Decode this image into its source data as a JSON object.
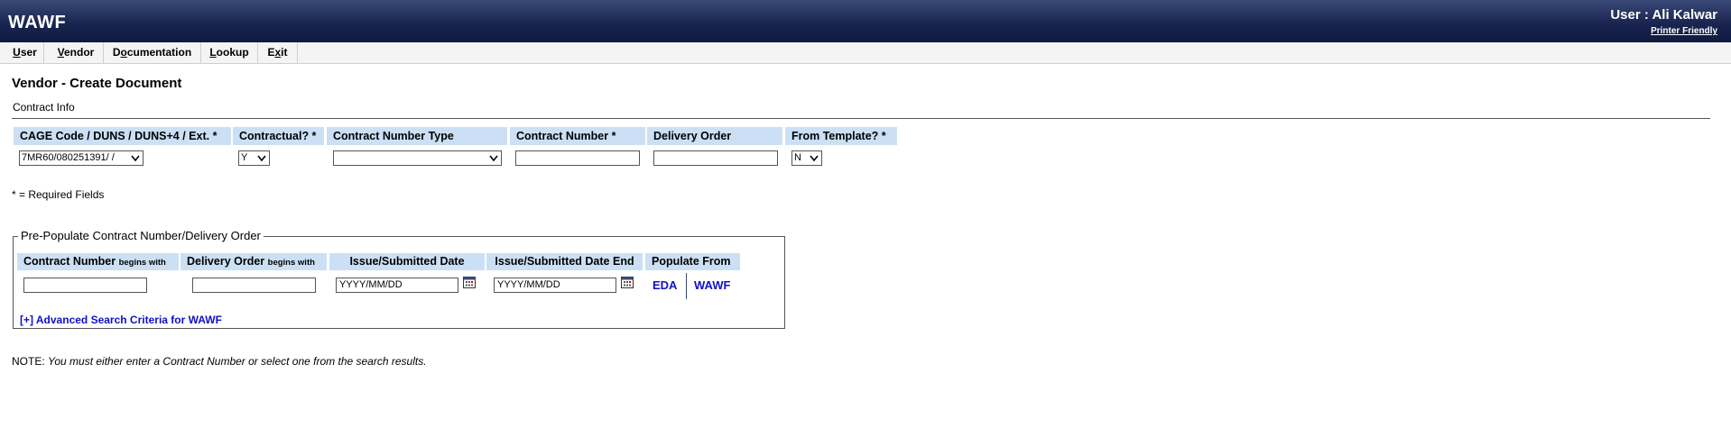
{
  "header": {
    "app_title": "WAWF",
    "user_label": "User : Ali Kalwar",
    "printer_friendly": "Printer Friendly"
  },
  "menu": [
    {
      "underline": "U",
      "rest": "ser"
    },
    {
      "underline": "V",
      "rest": "endor"
    },
    {
      "pre": "D",
      "underline": "o",
      "rest": "cumentation"
    },
    {
      "underline": "L",
      "rest": "ookup"
    },
    {
      "pre": "E",
      "underline": "x",
      "rest": "it"
    }
  ],
  "page": {
    "title": "Vendor - Create Document",
    "section": "Contract Info"
  },
  "contract_info": {
    "headers": {
      "cage": "CAGE Code / DUNS / DUNS+4 / Ext. *",
      "contractual": "Contractual? *",
      "contract_type": "Contract Number Type",
      "contract_number": "Contract Number *",
      "delivery_order": "Delivery Order",
      "from_template": "From Template? *"
    },
    "values": {
      "cage": "7MR60/080251391/ /",
      "contractual": "Y",
      "contract_type": "",
      "contract_number": "",
      "delivery_order": "",
      "from_template": "N"
    }
  },
  "required_note": "* = Required Fields",
  "prepopulate": {
    "legend": "Pre-Populate Contract Number/Delivery Order",
    "headers": {
      "contract_number": "Contract Number",
      "contract_number_small": "begins with",
      "delivery_order": "Delivery Order",
      "delivery_order_small": "begins with",
      "issue_date": "Issue/Submitted Date",
      "issue_date_end": "Issue/Submitted Date End",
      "populate_from": "Populate From"
    },
    "placeholders": {
      "issue_date": "YYYY/MM/DD",
      "issue_date_end": "YYYY/MM/DD"
    },
    "links": {
      "eda": "EDA",
      "wawf": "WAWF"
    },
    "advanced": "[+] Advanced Search Criteria for WAWF"
  },
  "note": {
    "label": "NOTE:",
    "text": "You must either enter a Contract Number or select one from the search results."
  },
  "icons": {
    "calendar": "calendar-icon",
    "dropdown": "chevron-down-icon"
  },
  "colors": {
    "header_bg": "#1a2550",
    "column_header_bg": "#cce0f5",
    "link": "#1010c8"
  }
}
